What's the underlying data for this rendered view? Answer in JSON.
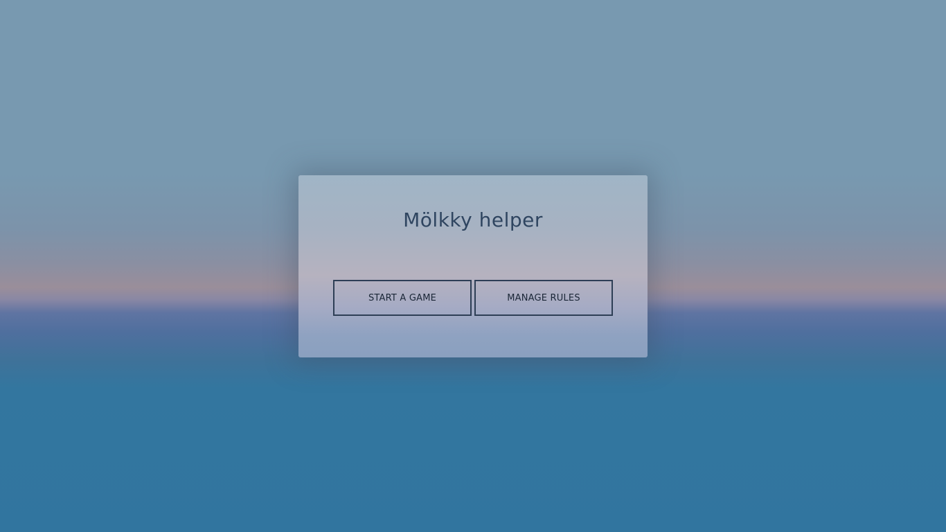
{
  "app": {
    "title": "Mölkky helper"
  },
  "actions": {
    "start_game_label": "START A GAME",
    "manage_rules_label": "MANAGE RULES"
  },
  "colors": {
    "button_border": "#2d3e55",
    "title_text": "#2f4560",
    "sky_top": "#7899b0",
    "sea_bottom": "#31759f"
  }
}
